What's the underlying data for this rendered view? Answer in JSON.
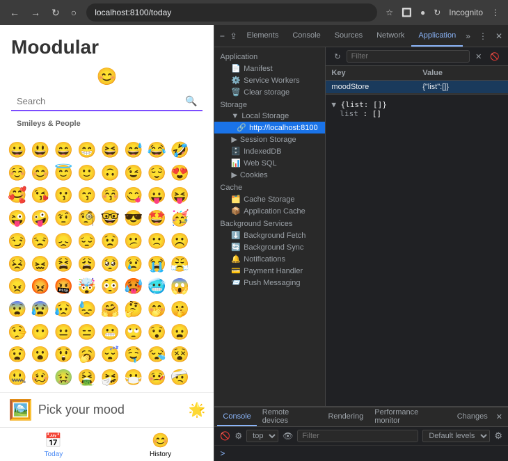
{
  "browser": {
    "url": "localhost:8100/today",
    "device": "Pixel 2",
    "dimensions": "411 × 731",
    "zoom": "100%",
    "title_tab": "Incognito"
  },
  "devtools_tabs": [
    {
      "label": "Elements",
      "active": false
    },
    {
      "label": "Console",
      "active": false
    },
    {
      "label": "Sources",
      "active": false
    },
    {
      "label": "Network",
      "active": false
    },
    {
      "label": "Application",
      "active": true
    }
  ],
  "app": {
    "title": "Moodular",
    "search_placeholder": "Search",
    "category": "Smileys & People",
    "emojis": [
      "😀",
      "😃",
      "😄",
      "😁",
      "😆",
      "😅",
      "😂",
      "🤣",
      "☺️",
      "😊",
      "😇",
      "🙂",
      "🙃",
      "😉",
      "😌",
      "😍",
      "🥰",
      "😘",
      "😗",
      "😙",
      "😚",
      "😋",
      "😛",
      "😝",
      "😜",
      "🤪",
      "🤨",
      "🧐",
      "🤓",
      "😎",
      "🤩",
      "🥳",
      "😏",
      "😒",
      "😞",
      "😔",
      "😟",
      "😕",
      "🙁",
      "☹️",
      "😣",
      "😖",
      "😫",
      "😩",
      "🥺",
      "😢",
      "😭",
      "😤",
      "😠",
      "😡",
      "🤬",
      "🤯",
      "😳",
      "🥵",
      "🥶",
      "😱",
      "😨",
      "😰",
      "😥",
      "😓",
      "🤗",
      "🤔",
      "🤭",
      "🤫",
      "🤥",
      "😶",
      "😐",
      "😑",
      "😬",
      "🙄",
      "😯",
      "😦",
      "😧",
      "😮",
      "😲",
      "🥱",
      "😴",
      "🤤",
      "😪",
      "😵",
      "🤐",
      "🥴",
      "🤢",
      "🤮",
      "🤧",
      "😷",
      "🤒",
      "🤕"
    ],
    "mood_text": "Pick your mood",
    "mood_emoji": "🖼️",
    "sun": "🌟"
  },
  "bottom_tabs": [
    {
      "label": "Today",
      "active": true,
      "icon": "📅"
    },
    {
      "label": "History",
      "active": false,
      "icon": "😊"
    }
  ],
  "devtools": {
    "filter_placeholder": "Filter",
    "sidebar": {
      "application_section": "Application",
      "application_items": [
        {
          "label": "Manifest",
          "icon": "📄",
          "indent": 1
        },
        {
          "label": "Service Workers",
          "icon": "⚙️",
          "indent": 1
        },
        {
          "label": "Clear storage",
          "icon": "🗑️",
          "indent": 1
        }
      ],
      "storage_section": "Storage",
      "storage_items": [
        {
          "label": "Local Storage",
          "icon": "▶",
          "indent": 1,
          "expandable": true
        },
        {
          "label": "http://localhost:8100",
          "icon": "🔗",
          "indent": 2,
          "selected": true
        },
        {
          "label": "Session Storage",
          "icon": "▶",
          "indent": 1,
          "expandable": true
        },
        {
          "label": "IndexedDB",
          "icon": "🗄️",
          "indent": 1
        },
        {
          "label": "Web SQL",
          "icon": "📊",
          "indent": 1
        },
        {
          "label": "Cookies",
          "icon": "▶",
          "indent": 1,
          "expandable": true
        }
      ],
      "cache_section": "Cache",
      "cache_items": [
        {
          "label": "Cache Storage",
          "icon": "🗂️",
          "indent": 1
        },
        {
          "label": "Application Cache",
          "icon": "📦",
          "indent": 1
        }
      ],
      "bg_section": "Background Services",
      "bg_items": [
        {
          "label": "Background Fetch",
          "icon": "⬇️",
          "indent": 1
        },
        {
          "label": "Background Sync",
          "icon": "🔄",
          "indent": 1
        },
        {
          "label": "Notifications",
          "icon": "🔔",
          "indent": 1
        },
        {
          "label": "Payment Handler",
          "icon": "💳",
          "indent": 1
        },
        {
          "label": "Push Messaging",
          "icon": "📨",
          "indent": 1
        }
      ]
    },
    "table": {
      "columns": [
        "Key",
        "Value"
      ],
      "rows": [
        {
          "key": "moodStore",
          "value": "{\"list\":[]}",
          "selected": true
        }
      ]
    },
    "json_preview": {
      "root": "{list: []}",
      "children": [
        {
          "key": "list",
          "value": "[]"
        }
      ]
    }
  },
  "console": {
    "tabs": [
      {
        "label": "Console",
        "active": true
      },
      {
        "label": "Remote devices",
        "active": false
      },
      {
        "label": "Rendering",
        "active": false
      },
      {
        "label": "Performance monitor",
        "active": false
      },
      {
        "label": "Changes",
        "active": false
      }
    ],
    "context_select": "top",
    "filter_placeholder": "Filter",
    "levels_label": "Default levels",
    "prompt": ">"
  }
}
